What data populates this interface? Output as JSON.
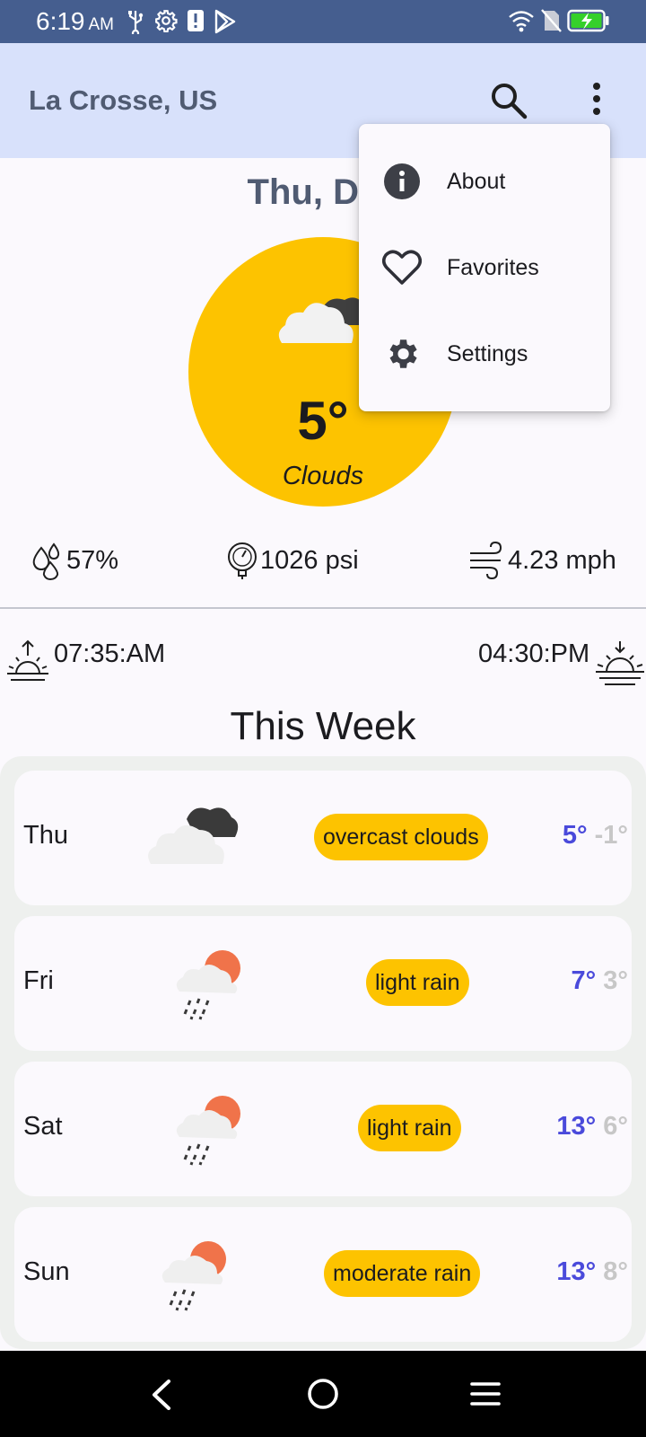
{
  "status_bar": {
    "time": "6:19",
    "ampm": "AM"
  },
  "app_bar": {
    "title": "La Crosse, US"
  },
  "current": {
    "date": "Thu, Dec",
    "temperature": "5°",
    "description": "Clouds",
    "humidity": "57%",
    "pressure": "1026 psi",
    "wind": "4.23 mph",
    "sunrise": "07:35:AM",
    "sunset": "04:30:PM"
  },
  "week": {
    "title": "This Week",
    "days": [
      {
        "day": "Thu",
        "desc": "overcast clouds",
        "high": "5°",
        "low": "-1°",
        "icon": "overcast-clouds-icon"
      },
      {
        "day": "Fri",
        "desc": "light rain",
        "high": "7°",
        "low": "3°",
        "icon": "rain-sun-icon"
      },
      {
        "day": "Sat",
        "desc": "light rain",
        "high": "13°",
        "low": "6°",
        "icon": "rain-sun-icon"
      },
      {
        "day": "Sun",
        "desc": "moderate rain",
        "high": "13°",
        "low": "8°",
        "icon": "rain-sun-icon"
      }
    ]
  },
  "menu": {
    "items": [
      {
        "label": "About",
        "icon": "info-icon"
      },
      {
        "label": "Favorites",
        "icon": "heart-outline-icon"
      },
      {
        "label": "Settings",
        "icon": "gear-icon"
      }
    ]
  },
  "colors": {
    "accent": "#fdc300",
    "app_bar": "#d8e1fb",
    "status_bar": "#455e8f",
    "high_temp": "#4a4adb",
    "low_temp": "#c7c7c7"
  }
}
